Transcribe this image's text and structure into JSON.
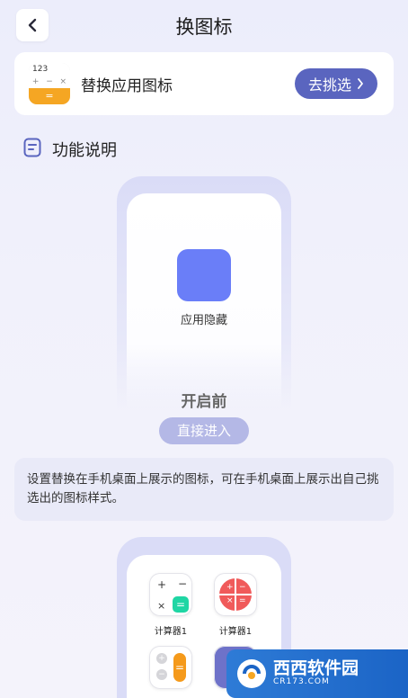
{
  "header": {
    "title": "换图标"
  },
  "replace_card": {
    "label": "替换应用图标",
    "button_label": "去挑选",
    "icon_display": "123"
  },
  "section": {
    "title": "功能说明"
  },
  "preview_before": {
    "app_label": "应用隐藏",
    "state_label": "开启前",
    "button_label": "直接进入"
  },
  "description": {
    "text": "设置替换在手机桌面上展示的图标，可在手机桌面上展示出自己挑选出的图标样式。"
  },
  "preview_after": {
    "apps": [
      {
        "label": "计算器1"
      },
      {
        "label": "计算器1"
      }
    ]
  },
  "watermark": {
    "text": "西西软件园",
    "sub": "CR173.COM"
  },
  "colors": {
    "accent": "#5a65bf",
    "app_blue": "#6a7ef8",
    "calc_orange": "#f5a623",
    "calc_red": "#f05a5a",
    "calc_green": "#1fd6a4"
  }
}
